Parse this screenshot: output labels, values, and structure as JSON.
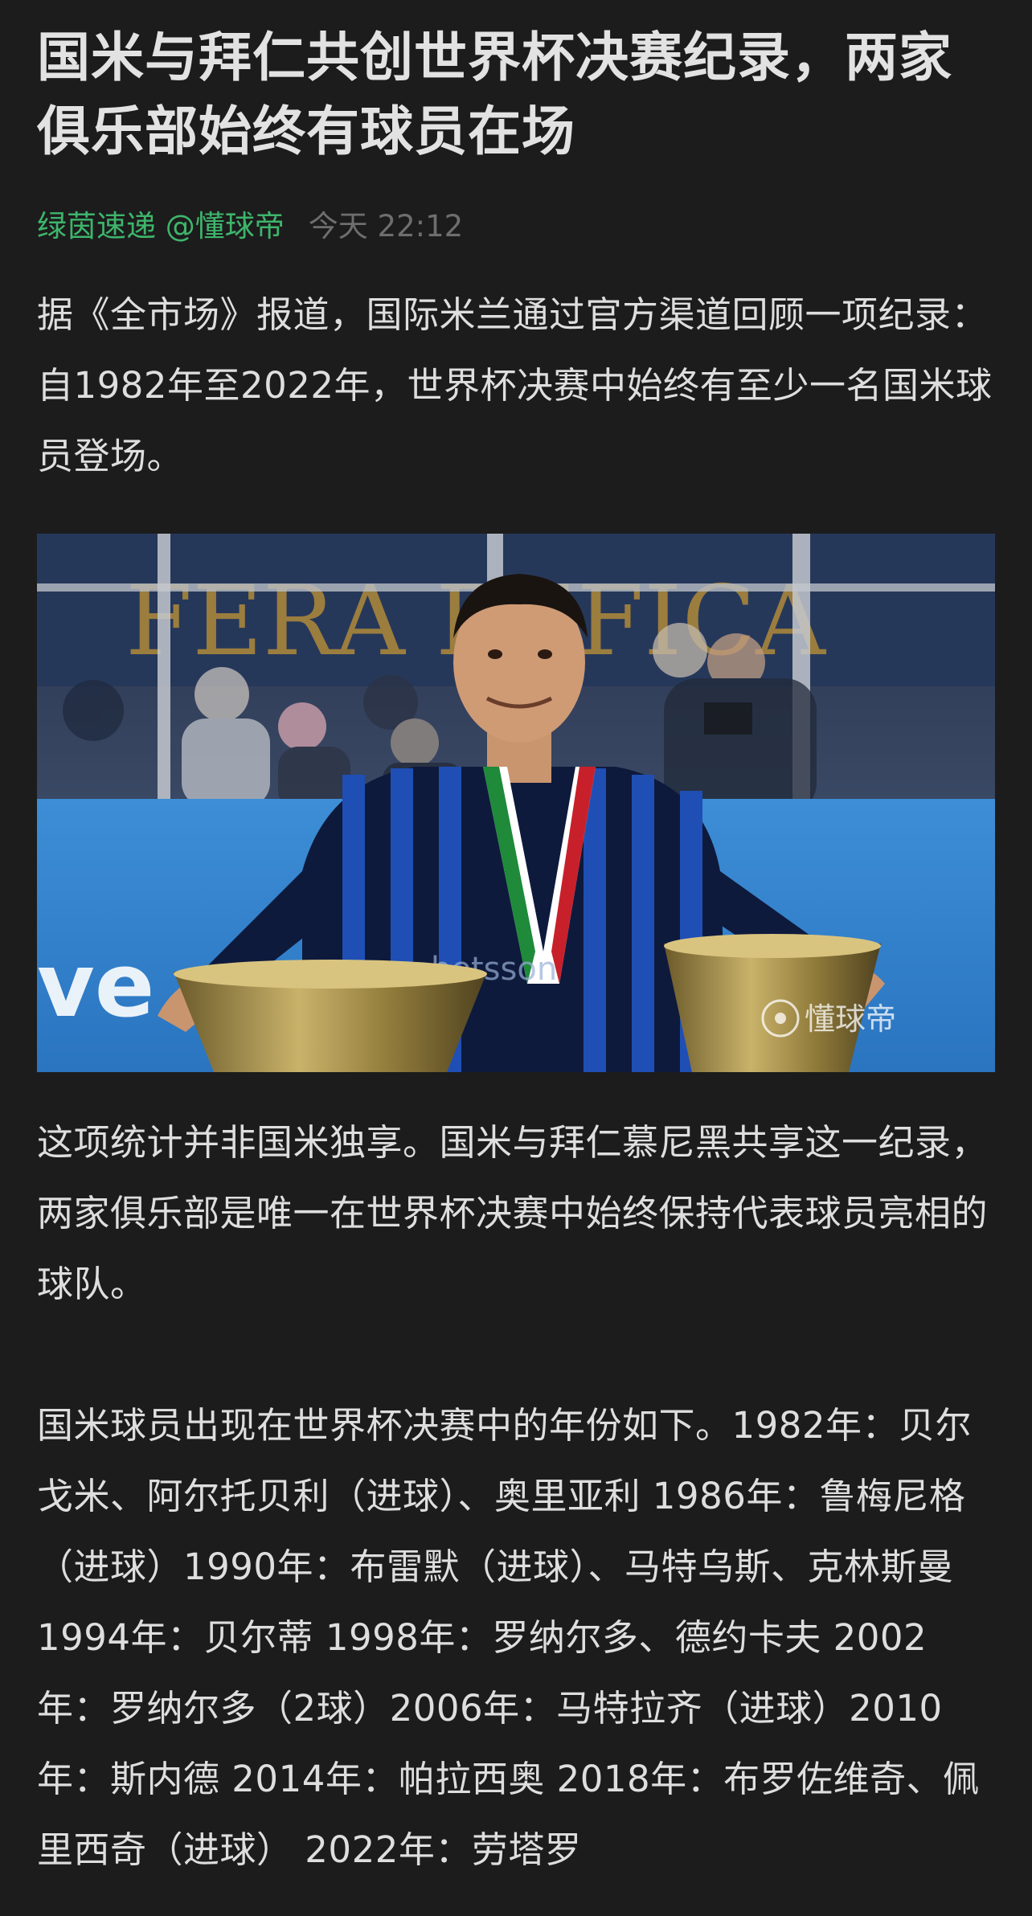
{
  "article": {
    "title": "国米与拜仁共创世界杯决赛纪录，两家俱乐部始终有球员在场",
    "author": "绿茵速递 @懂球帝",
    "time": "今天 22:12",
    "paragraphs": [
      "据《全市场》报道，国际米兰通过官方渠道回顾一项纪录：自1982年至2022年，世界杯决赛中始终有至少一名国米球员登场。",
      "这项统计并非国米独享。国米与拜仁慕尼黑共享这一纪录，两家俱乐部是唯一在世界杯决赛中始终保持代表球员亮相的球队。",
      "国米球员出现在世界杯决赛中的年份如下。1982年：贝尔戈米、阿尔托贝利（进球）、奥里亚利 1986年：鲁梅尼格（进球）1990年：布雷默（进球）、马特乌斯、克林斯曼 1994年：贝尔蒂 1998年：罗纳尔多、德约卡夫 2002年：罗纳尔多（2球）2006年：马特拉齐（进球）2010年：斯内德 2014年：帕拉西奥 2018年：布罗佐维奇、佩里西奇（进球） 2022年：劳塔罗"
    ],
    "image": {
      "stand_banner_text": "FERA  BEFICA",
      "board_text": "ve",
      "shirt_sponsor_text": "betsson",
      "watermark": "懂球帝"
    }
  },
  "colors": {
    "background": "#1c1c1c",
    "author": "#3eb56c",
    "time": "#6e6e6e"
  }
}
